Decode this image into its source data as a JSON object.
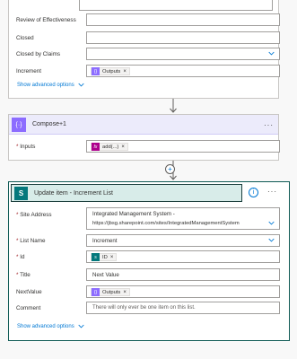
{
  "top_card": {
    "fields": [
      {
        "label": "Review of Effectiveness",
        "value": ""
      },
      {
        "label": "Closed",
        "value": ""
      },
      {
        "label": "Closed by Claims",
        "value": ""
      },
      {
        "label": "Increment",
        "token": "Outputs"
      }
    ],
    "advanced_link": "Show advanced options"
  },
  "compose": {
    "title": "Compose+1",
    "inputs_label": "Inputs",
    "inputs_token": "add(...)",
    "menu": "···"
  },
  "add_step_symbol": "+",
  "update": {
    "icon_letter": "S",
    "title": "Update item - Increment List",
    "info_symbol": "i",
    "menu": "···",
    "site_label": "Site Address",
    "site_value_line1": "Integrated Management System -",
    "site_value_line2": "https://jbsg.sharepoint.com/sites/IntegratedManagementSystem",
    "list_label": "List Name",
    "list_value": "Increment",
    "id_label": "Id",
    "id_token": "ID",
    "title_label": "Title",
    "title_value": "Next Value",
    "nextvalue_label": "NextValue",
    "nextvalue_token": "Outputs",
    "comment_label": "Comment",
    "comment_placeholder": "There will only ever be one item on this list.",
    "advanced_link": "Show advanced options"
  },
  "required_mark": "*",
  "remove_symbol": "×",
  "colors": {
    "compose_accent": "#8c6cff",
    "expression_accent": "#ad008c",
    "sharepoint_accent": "#03787c",
    "link": "#0078d4"
  }
}
